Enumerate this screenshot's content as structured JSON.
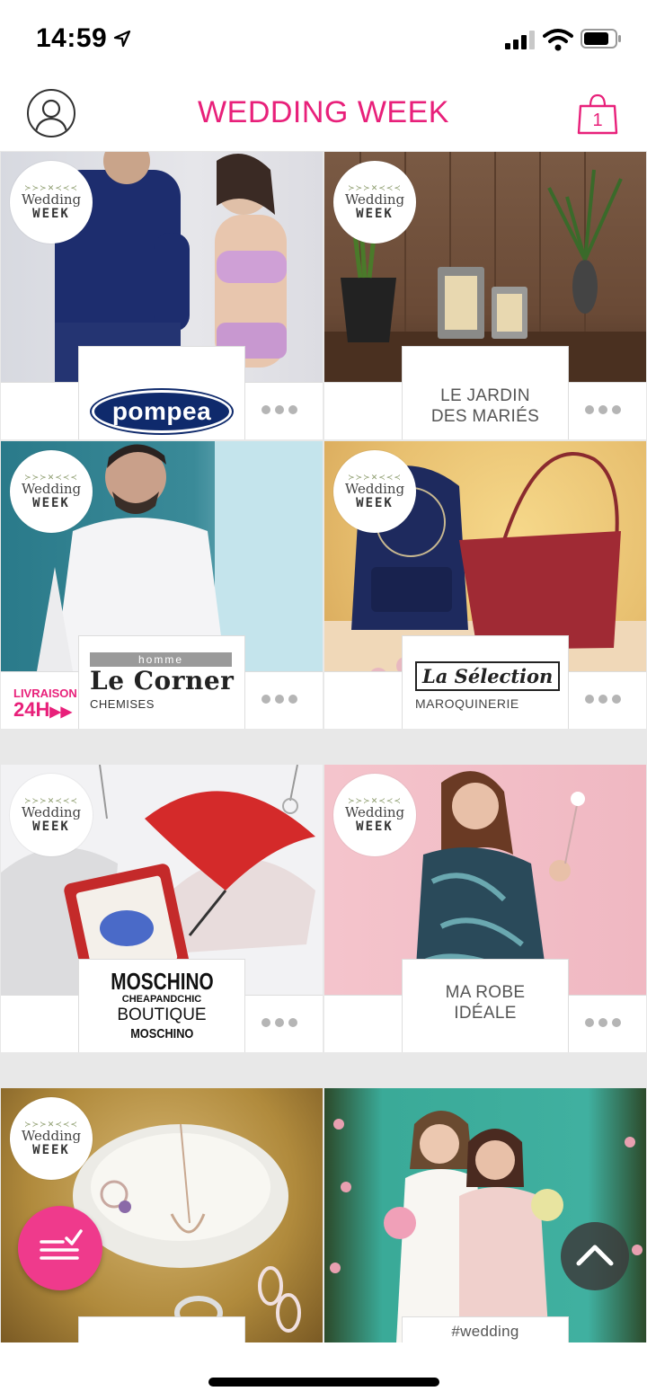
{
  "status_bar": {
    "time": "14:59"
  },
  "header": {
    "title": "WEDDING WEEK",
    "cart_count": "1"
  },
  "badge": {
    "line1": "Wedding",
    "line2": "WEEK",
    "ornament": "≻≻≻✕≺≺≺"
  },
  "tiles": [
    {
      "label": "pompea",
      "type": "logo-pompea"
    },
    {
      "label_line1": "LE JARDIN",
      "label_line2": "DES MARIÉS",
      "type": "text"
    },
    {
      "logo_top": "homme",
      "logo_main": "Le Corner",
      "logo_sub": "CHEMISES",
      "delivery_line1": "LIVRAISON",
      "delivery_line2": "24H",
      "type": "logo-lecorner"
    },
    {
      "logo_main": "La Sélection",
      "logo_sub": "MAROQUINERIE",
      "type": "logo-selection"
    },
    {
      "logo_l1": "MOSCHINO",
      "logo_l2": "CHEAPANDCHIC",
      "logo_l3": "BOUTIQUE",
      "logo_l4": "MOSCHINO",
      "type": "logo-moschino"
    },
    {
      "label_line1": "MA ROBE",
      "label_line2": "IDÉALE",
      "type": "text"
    },
    {
      "label": "",
      "type": "partial"
    },
    {
      "label": "#wedding",
      "type": "partial"
    }
  ],
  "colors": {
    "accent": "#e8207a",
    "fab": "#ef3a8c"
  }
}
